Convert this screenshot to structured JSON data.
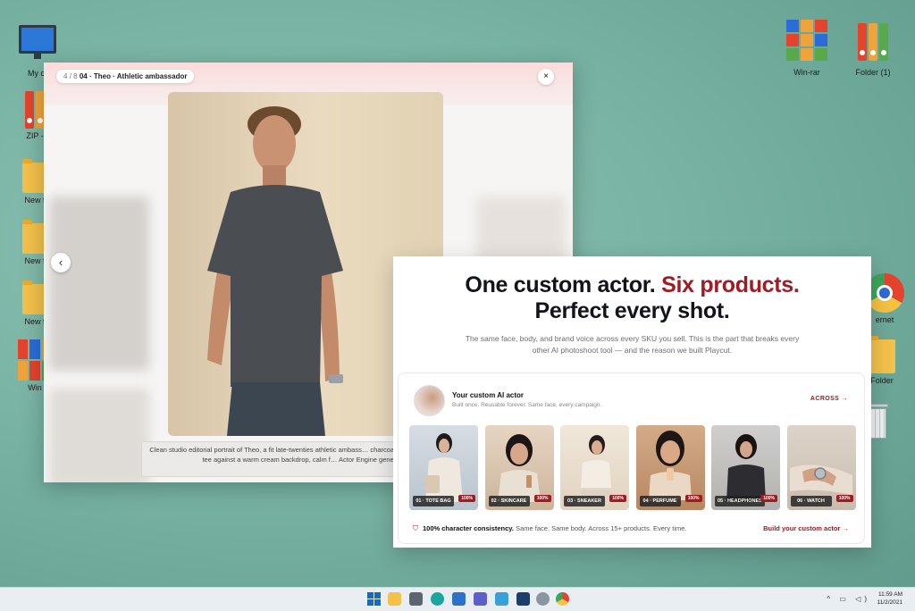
{
  "desktop": {
    "icons_left": [
      {
        "label": "My co"
      },
      {
        "label": "ZIP -"
      },
      {
        "label": "New f"
      },
      {
        "label": "New f"
      },
      {
        "label": "New f"
      },
      {
        "label": "Win"
      }
    ],
    "icons_right": [
      {
        "label": "Win-rar"
      },
      {
        "label": "Folder (1)"
      },
      {
        "label": "ernet"
      },
      {
        "label": "Folder"
      }
    ]
  },
  "lightbox": {
    "counter_current": "4",
    "counter_sep": "/",
    "counter_total": "8",
    "title": "04 · Theo · Athletic ambassador",
    "close_icon": "×",
    "prev_icon": "‹",
    "caption": "Clean studio editorial portrait of Theo, a fit late-twenties athletic ambass… charcoal technical performance tee against a warm cream backdrop, calm f… Actor Engine generation"
  },
  "landing": {
    "headline_part1": "One custom actor.",
    "headline_red": "Six products.",
    "headline_line2": "Perfect every shot.",
    "subtext": "The same face, body, and brand voice across every SKU you sell. This is the part that breaks every other AI photoshoot tool — and the reason we built Playcut.",
    "actor_title": "Your custom AI actor",
    "actor_subtitle": "Built once. Reusable forever. Same face, every campaign.",
    "across_link": "ACROSS →",
    "cards": [
      {
        "label": "01 · TOTE BAG",
        "pct": "100%",
        "bg": "#c9d3dc"
      },
      {
        "label": "02 · SKINCARE",
        "pct": "100%",
        "bg": "#d9c6b4"
      },
      {
        "label": "03 · SNEAKER",
        "pct": "100%",
        "bg": "#e7dccb"
      },
      {
        "label": "04 · PERFUME",
        "pct": "100%",
        "bg": "#c89f7e"
      },
      {
        "label": "05 · HEADPHONES",
        "pct": "100%",
        "bg": "#c5c4c2"
      },
      {
        "label": "06 · WATCH",
        "pct": "100%",
        "bg": "#d7cfc4"
      }
    ],
    "footer_bold": "100% character consistency.",
    "footer_text": " Same face. Same body. Across 15+ products. Every time.",
    "build_link": "Build your custom actor →"
  },
  "taskbar": {
    "time": "11:59 AM",
    "date": "11/2/2021",
    "accent": "#0a6ed1"
  }
}
